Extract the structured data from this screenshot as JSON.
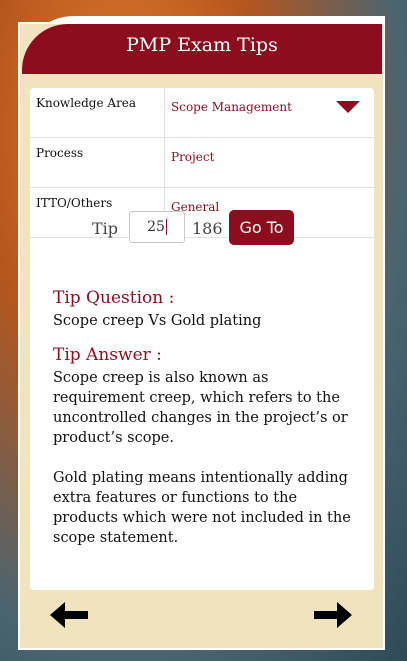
{
  "header": {
    "title": "PMP Exam Tips"
  },
  "selectors": [
    {
      "label": "Knowledge Area",
      "value": "Scope Management",
      "dropdown": true
    },
    {
      "label": "Process",
      "value": "Project",
      "dropdown": false
    },
    {
      "label": "ITTO/Others",
      "value": "General",
      "dropdown": false
    }
  ],
  "navigator": {
    "label": "Tip",
    "current": "25",
    "total": "186",
    "button": "Go To"
  },
  "question": {
    "title": "Tip Question :",
    "text": "Scope creep Vs Gold plating"
  },
  "answer": {
    "title": "Tip Answer :",
    "text": "Scope creep is also known as requirement creep, which refers to the uncontrolled changes in the project’s or product’s scope.\n\nGold plating means intentionally adding extra features or functions to the products which were not included in the scope statement."
  },
  "footer": {
    "prev_icon": "arrow-left-icon",
    "next_icon": "arrow-right-icon"
  },
  "colors": {
    "accent": "#8b0d1e",
    "panel": "#efe4bd"
  }
}
